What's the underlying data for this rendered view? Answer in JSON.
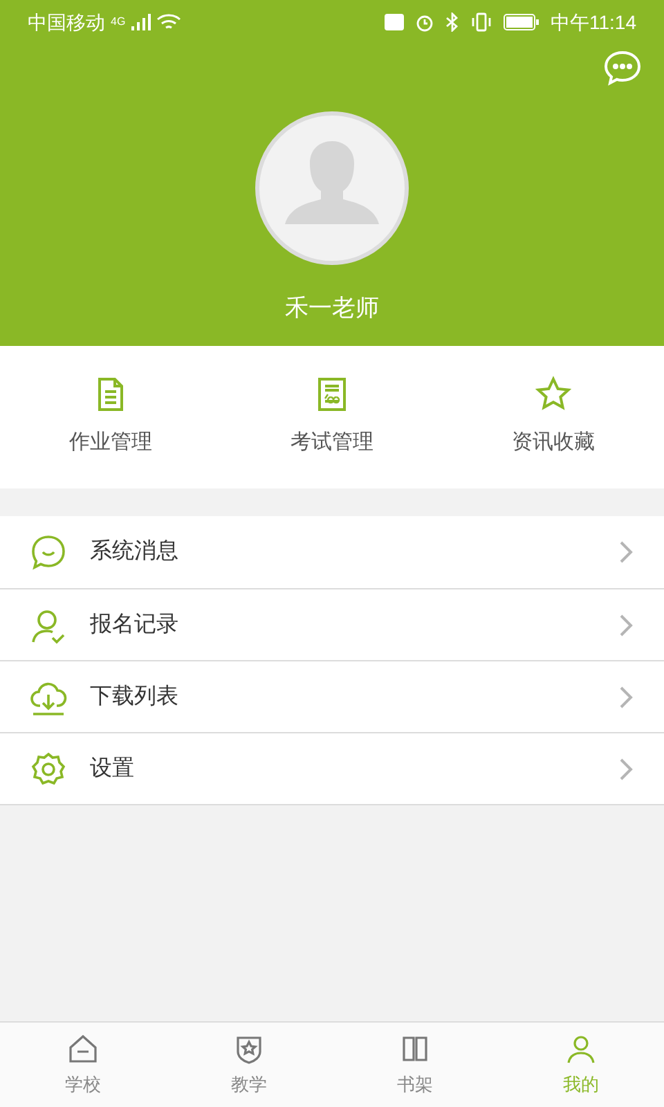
{
  "status_bar": {
    "carrier": "中国移动",
    "network": "4G",
    "time": "中午11:14"
  },
  "profile": {
    "name": "禾一老师"
  },
  "shortcuts": [
    {
      "kind": "homework",
      "label": "作业管理"
    },
    {
      "kind": "exam",
      "label": "考试管理"
    },
    {
      "kind": "favorites",
      "label": "资讯收藏"
    }
  ],
  "menu": [
    {
      "kind": "messages",
      "label": "系统消息"
    },
    {
      "kind": "signup",
      "label": "报名记录"
    },
    {
      "kind": "download",
      "label": "下载列表"
    },
    {
      "kind": "settings",
      "label": "设置"
    }
  ],
  "tabs": [
    {
      "kind": "school",
      "label": "学校",
      "selected": false
    },
    {
      "kind": "teaching",
      "label": "教学",
      "selected": false
    },
    {
      "kind": "shelf",
      "label": "书架",
      "selected": false
    },
    {
      "kind": "mine",
      "label": "我的",
      "selected": true
    }
  ]
}
